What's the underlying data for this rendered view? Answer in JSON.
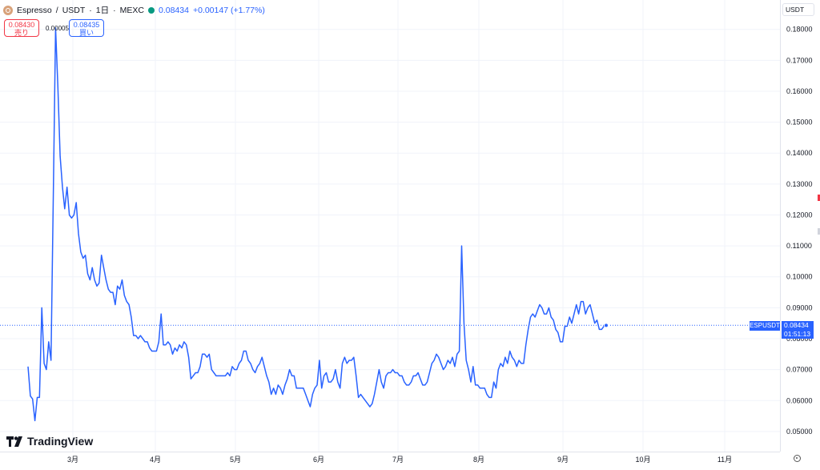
{
  "header": {
    "symbol_name": "Espresso",
    "separator": "/",
    "quote_currency": "USDT",
    "interval": "1日",
    "exchange": "MEXC",
    "last_price": "0.08434",
    "change": "+0.00147 (+1.77%)",
    "sell_price": "0.08430",
    "sell_label": "売り",
    "spread": "0.00005",
    "buy_price": "0.08435",
    "buy_label": "買い"
  },
  "toolbar": {
    "currency_button": "USDT"
  },
  "price_tag": {
    "symbol": "ESPUSDT",
    "price": "0.08434",
    "countdown": "01:51:13"
  },
  "branding": {
    "logo_text": "TradingView"
  },
  "colors": {
    "line": "#2962ff",
    "grid": "#f0f3fa",
    "up": "#089981",
    "down": "#f23645"
  },
  "chart_data": {
    "type": "line",
    "ylim": [
      0.0435,
      0.1895
    ],
    "y_ticks": [
      "0.05000",
      "0.06000",
      "0.07000",
      "0.08000",
      "0.09000",
      "0.10000",
      "0.11000",
      "0.12000",
      "0.13000",
      "0.14000",
      "0.15000",
      "0.16000",
      "0.17000",
      "0.18000"
    ],
    "x_ticks": [
      "3月",
      "4月",
      "5月",
      "6月",
      "7月",
      "8月",
      "9月",
      "10月",
      "11月"
    ],
    "last_value": 0.08434,
    "series": [
      {
        "values": [
          [
            0,
            0.071
          ],
          [
            1,
            0.0615
          ],
          [
            2,
            0.0605
          ],
          [
            3,
            0.0535
          ],
          [
            4,
            0.061
          ],
          [
            5,
            0.061
          ],
          [
            6,
            0.09
          ],
          [
            7,
            0.072
          ],
          [
            8,
            0.07
          ],
          [
            9,
            0.079
          ],
          [
            10,
            0.073
          ],
          [
            11,
            0.125
          ],
          [
            12,
            0.1805
          ],
          [
            13,
            0.162
          ],
          [
            14,
            0.139
          ],
          [
            15,
            0.129
          ],
          [
            16,
            0.122
          ],
          [
            17,
            0.129
          ],
          [
            18,
            0.12
          ],
          [
            19,
            0.119
          ],
          [
            20,
            0.12
          ],
          [
            21,
            0.124
          ],
          [
            22,
            0.114
          ],
          [
            23,
            0.108
          ],
          [
            24,
            0.106
          ],
          [
            25,
            0.107
          ],
          [
            26,
            0.101
          ],
          [
            27,
            0.099
          ],
          [
            28,
            0.103
          ],
          [
            29,
            0.099
          ],
          [
            30,
            0.097
          ],
          [
            31,
            0.098
          ],
          [
            32,
            0.107
          ],
          [
            33,
            0.103
          ],
          [
            34,
            0.099
          ],
          [
            35,
            0.096
          ],
          [
            36,
            0.095
          ],
          [
            37,
            0.095
          ],
          [
            38,
            0.091
          ],
          [
            39,
            0.097
          ],
          [
            40,
            0.096
          ],
          [
            41,
            0.099
          ],
          [
            42,
            0.094
          ],
          [
            43,
            0.092
          ],
          [
            44,
            0.091
          ],
          [
            45,
            0.087
          ],
          [
            46,
            0.081
          ],
          [
            47,
            0.081
          ],
          [
            48,
            0.08
          ],
          [
            49,
            0.081
          ],
          [
            50,
            0.08
          ],
          [
            51,
            0.079
          ],
          [
            52,
            0.079
          ],
          [
            53,
            0.077
          ],
          [
            54,
            0.076
          ],
          [
            55,
            0.076
          ],
          [
            56,
            0.076
          ],
          [
            57,
            0.079
          ],
          [
            58,
            0.088
          ],
          [
            59,
            0.078
          ],
          [
            60,
            0.078
          ],
          [
            61,
            0.079
          ],
          [
            62,
            0.078
          ],
          [
            63,
            0.075
          ],
          [
            64,
            0.077
          ],
          [
            65,
            0.076
          ],
          [
            66,
            0.078
          ],
          [
            67,
            0.077
          ],
          [
            68,
            0.079
          ],
          [
            69,
            0.078
          ],
          [
            70,
            0.074
          ],
          [
            71,
            0.067
          ],
          [
            72,
            0.068
          ],
          [
            73,
            0.069
          ],
          [
            74,
            0.069
          ],
          [
            75,
            0.071
          ],
          [
            76,
            0.075
          ],
          [
            77,
            0.075
          ],
          [
            78,
            0.074
          ],
          [
            79,
            0.075
          ],
          [
            80,
            0.07
          ],
          [
            81,
            0.069
          ],
          [
            82,
            0.068
          ],
          [
            83,
            0.068
          ],
          [
            84,
            0.068
          ],
          [
            85,
            0.068
          ],
          [
            86,
            0.068
          ],
          [
            87,
            0.069
          ],
          [
            88,
            0.068
          ],
          [
            89,
            0.071
          ],
          [
            90,
            0.07
          ],
          [
            91,
            0.07
          ],
          [
            92,
            0.072
          ],
          [
            93,
            0.073
          ],
          [
            94,
            0.076
          ],
          [
            95,
            0.076
          ],
          [
            96,
            0.073
          ],
          [
            97,
            0.072
          ],
          [
            98,
            0.07
          ],
          [
            99,
            0.069
          ],
          [
            100,
            0.071
          ],
          [
            101,
            0.072
          ],
          [
            102,
            0.074
          ],
          [
            103,
            0.071
          ],
          [
            104,
            0.068
          ],
          [
            105,
            0.066
          ],
          [
            106,
            0.062
          ],
          [
            107,
            0.064
          ],
          [
            108,
            0.062
          ],
          [
            109,
            0.065
          ],
          [
            110,
            0.064
          ],
          [
            111,
            0.062
          ],
          [
            112,
            0.065
          ],
          [
            113,
            0.067
          ],
          [
            114,
            0.07
          ],
          [
            115,
            0.068
          ],
          [
            116,
            0.068
          ],
          [
            117,
            0.064
          ],
          [
            118,
            0.064
          ],
          [
            119,
            0.064
          ],
          [
            120,
            0.064
          ],
          [
            121,
            0.062
          ],
          [
            122,
            0.06
          ],
          [
            123,
            0.058
          ],
          [
            124,
            0.062
          ],
          [
            125,
            0.064
          ],
          [
            126,
            0.065
          ],
          [
            127,
            0.073
          ],
          [
            128,
            0.064
          ],
          [
            129,
            0.068
          ],
          [
            130,
            0.069
          ],
          [
            131,
            0.066
          ],
          [
            132,
            0.066
          ],
          [
            133,
            0.067
          ],
          [
            134,
            0.07
          ],
          [
            135,
            0.066
          ],
          [
            136,
            0.064
          ],
          [
            137,
            0.072
          ],
          [
            138,
            0.074
          ],
          [
            139,
            0.072
          ],
          [
            140,
            0.073
          ],
          [
            141,
            0.073
          ],
          [
            142,
            0.074
          ],
          [
            143,
            0.068
          ],
          [
            144,
            0.061
          ],
          [
            145,
            0.062
          ],
          [
            146,
            0.061
          ],
          [
            147,
            0.06
          ],
          [
            148,
            0.059
          ],
          [
            149,
            0.058
          ],
          [
            150,
            0.059
          ],
          [
            151,
            0.062
          ],
          [
            152,
            0.066
          ],
          [
            153,
            0.07
          ],
          [
            154,
            0.066
          ],
          [
            155,
            0.064
          ],
          [
            156,
            0.068
          ],
          [
            157,
            0.069
          ],
          [
            158,
            0.069
          ],
          [
            159,
            0.07
          ],
          [
            160,
            0.069
          ],
          [
            161,
            0.069
          ],
          [
            162,
            0.068
          ],
          [
            163,
            0.068
          ],
          [
            164,
            0.066
          ],
          [
            165,
            0.065
          ],
          [
            166,
            0.065
          ],
          [
            167,
            0.066
          ],
          [
            168,
            0.068
          ],
          [
            169,
            0.068
          ],
          [
            170,
            0.069
          ],
          [
            171,
            0.067
          ],
          [
            172,
            0.065
          ],
          [
            173,
            0.065
          ],
          [
            174,
            0.066
          ],
          [
            175,
            0.069
          ],
          [
            176,
            0.072
          ],
          [
            177,
            0.073
          ],
          [
            178,
            0.075
          ],
          [
            179,
            0.074
          ],
          [
            180,
            0.072
          ],
          [
            181,
            0.07
          ],
          [
            182,
            0.071
          ],
          [
            183,
            0.073
          ],
          [
            184,
            0.072
          ],
          [
            185,
            0.074
          ],
          [
            186,
            0.071
          ],
          [
            187,
            0.075
          ],
          [
            188,
            0.076
          ],
          [
            189,
            0.11
          ],
          [
            190,
            0.085
          ],
          [
            191,
            0.073
          ],
          [
            192,
            0.07
          ],
          [
            193,
            0.066
          ],
          [
            194,
            0.071
          ],
          [
            195,
            0.065
          ],
          [
            196,
            0.065
          ],
          [
            197,
            0.064
          ],
          [
            198,
            0.064
          ],
          [
            199,
            0.064
          ],
          [
            200,
            0.062
          ],
          [
            201,
            0.061
          ],
          [
            202,
            0.061
          ],
          [
            203,
            0.066
          ],
          [
            204,
            0.064
          ],
          [
            205,
            0.07
          ],
          [
            206,
            0.072
          ],
          [
            207,
            0.071
          ],
          [
            208,
            0.074
          ],
          [
            209,
            0.072
          ],
          [
            210,
            0.076
          ],
          [
            211,
            0.074
          ],
          [
            212,
            0.073
          ],
          [
            213,
            0.071
          ],
          [
            214,
            0.073
          ],
          [
            215,
            0.072
          ],
          [
            216,
            0.072
          ],
          [
            217,
            0.078
          ],
          [
            218,
            0.083
          ],
          [
            219,
            0.087
          ],
          [
            220,
            0.088
          ],
          [
            221,
            0.087
          ],
          [
            222,
            0.089
          ],
          [
            223,
            0.091
          ],
          [
            224,
            0.09
          ],
          [
            225,
            0.088
          ],
          [
            226,
            0.088
          ],
          [
            227,
            0.09
          ],
          [
            228,
            0.087
          ],
          [
            229,
            0.086
          ],
          [
            230,
            0.083
          ],
          [
            231,
            0.082
          ],
          [
            232,
            0.079
          ],
          [
            233,
            0.079
          ],
          [
            234,
            0.084
          ],
          [
            235,
            0.084
          ],
          [
            236,
            0.087
          ],
          [
            237,
            0.085
          ],
          [
            238,
            0.088
          ],
          [
            239,
            0.091
          ],
          [
            240,
            0.088
          ],
          [
            241,
            0.092
          ],
          [
            242,
            0.092
          ],
          [
            243,
            0.088
          ],
          [
            244,
            0.09
          ],
          [
            245,
            0.091
          ],
          [
            246,
            0.088
          ],
          [
            247,
            0.085
          ],
          [
            248,
            0.086
          ],
          [
            249,
            0.083
          ],
          [
            250,
            0.083
          ],
          [
            251,
            0.084
          ],
          [
            252,
            0.0843
          ]
        ]
      }
    ]
  }
}
